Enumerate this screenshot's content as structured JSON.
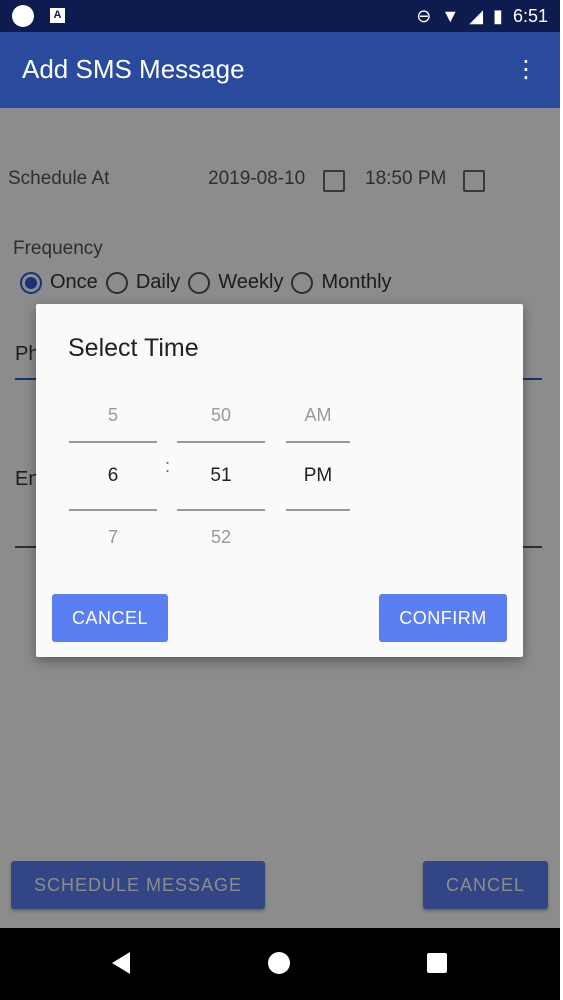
{
  "appbar": {
    "title": "Add SMS Message",
    "menu_icon": "overflow-menu-icon"
  },
  "schedule": {
    "label": "Schedule At",
    "date": "2019-08-10",
    "time": "18:50 PM"
  },
  "frequency": {
    "label": "Frequency",
    "options": [
      "Once",
      "Daily",
      "Weekly",
      "Monthly"
    ],
    "selected": "Once"
  },
  "fields": {
    "phone_hint": "Ph",
    "message_hint": "En"
  },
  "buttons": {
    "schedule": "SCHEDULE MESSAGE",
    "cancel": "CANCEL"
  },
  "dialog": {
    "title": "Select Time",
    "hour": {
      "prev": "5",
      "current": "6",
      "next": "7"
    },
    "minute": {
      "prev": "50",
      "current": "51",
      "next": "52"
    },
    "ampm": {
      "prev": "AM",
      "current": "PM"
    },
    "separator": ":",
    "cancel_label": "CANCEL",
    "confirm_label": "CONFIRM"
  },
  "status_bar": {
    "time": "6:51"
  }
}
